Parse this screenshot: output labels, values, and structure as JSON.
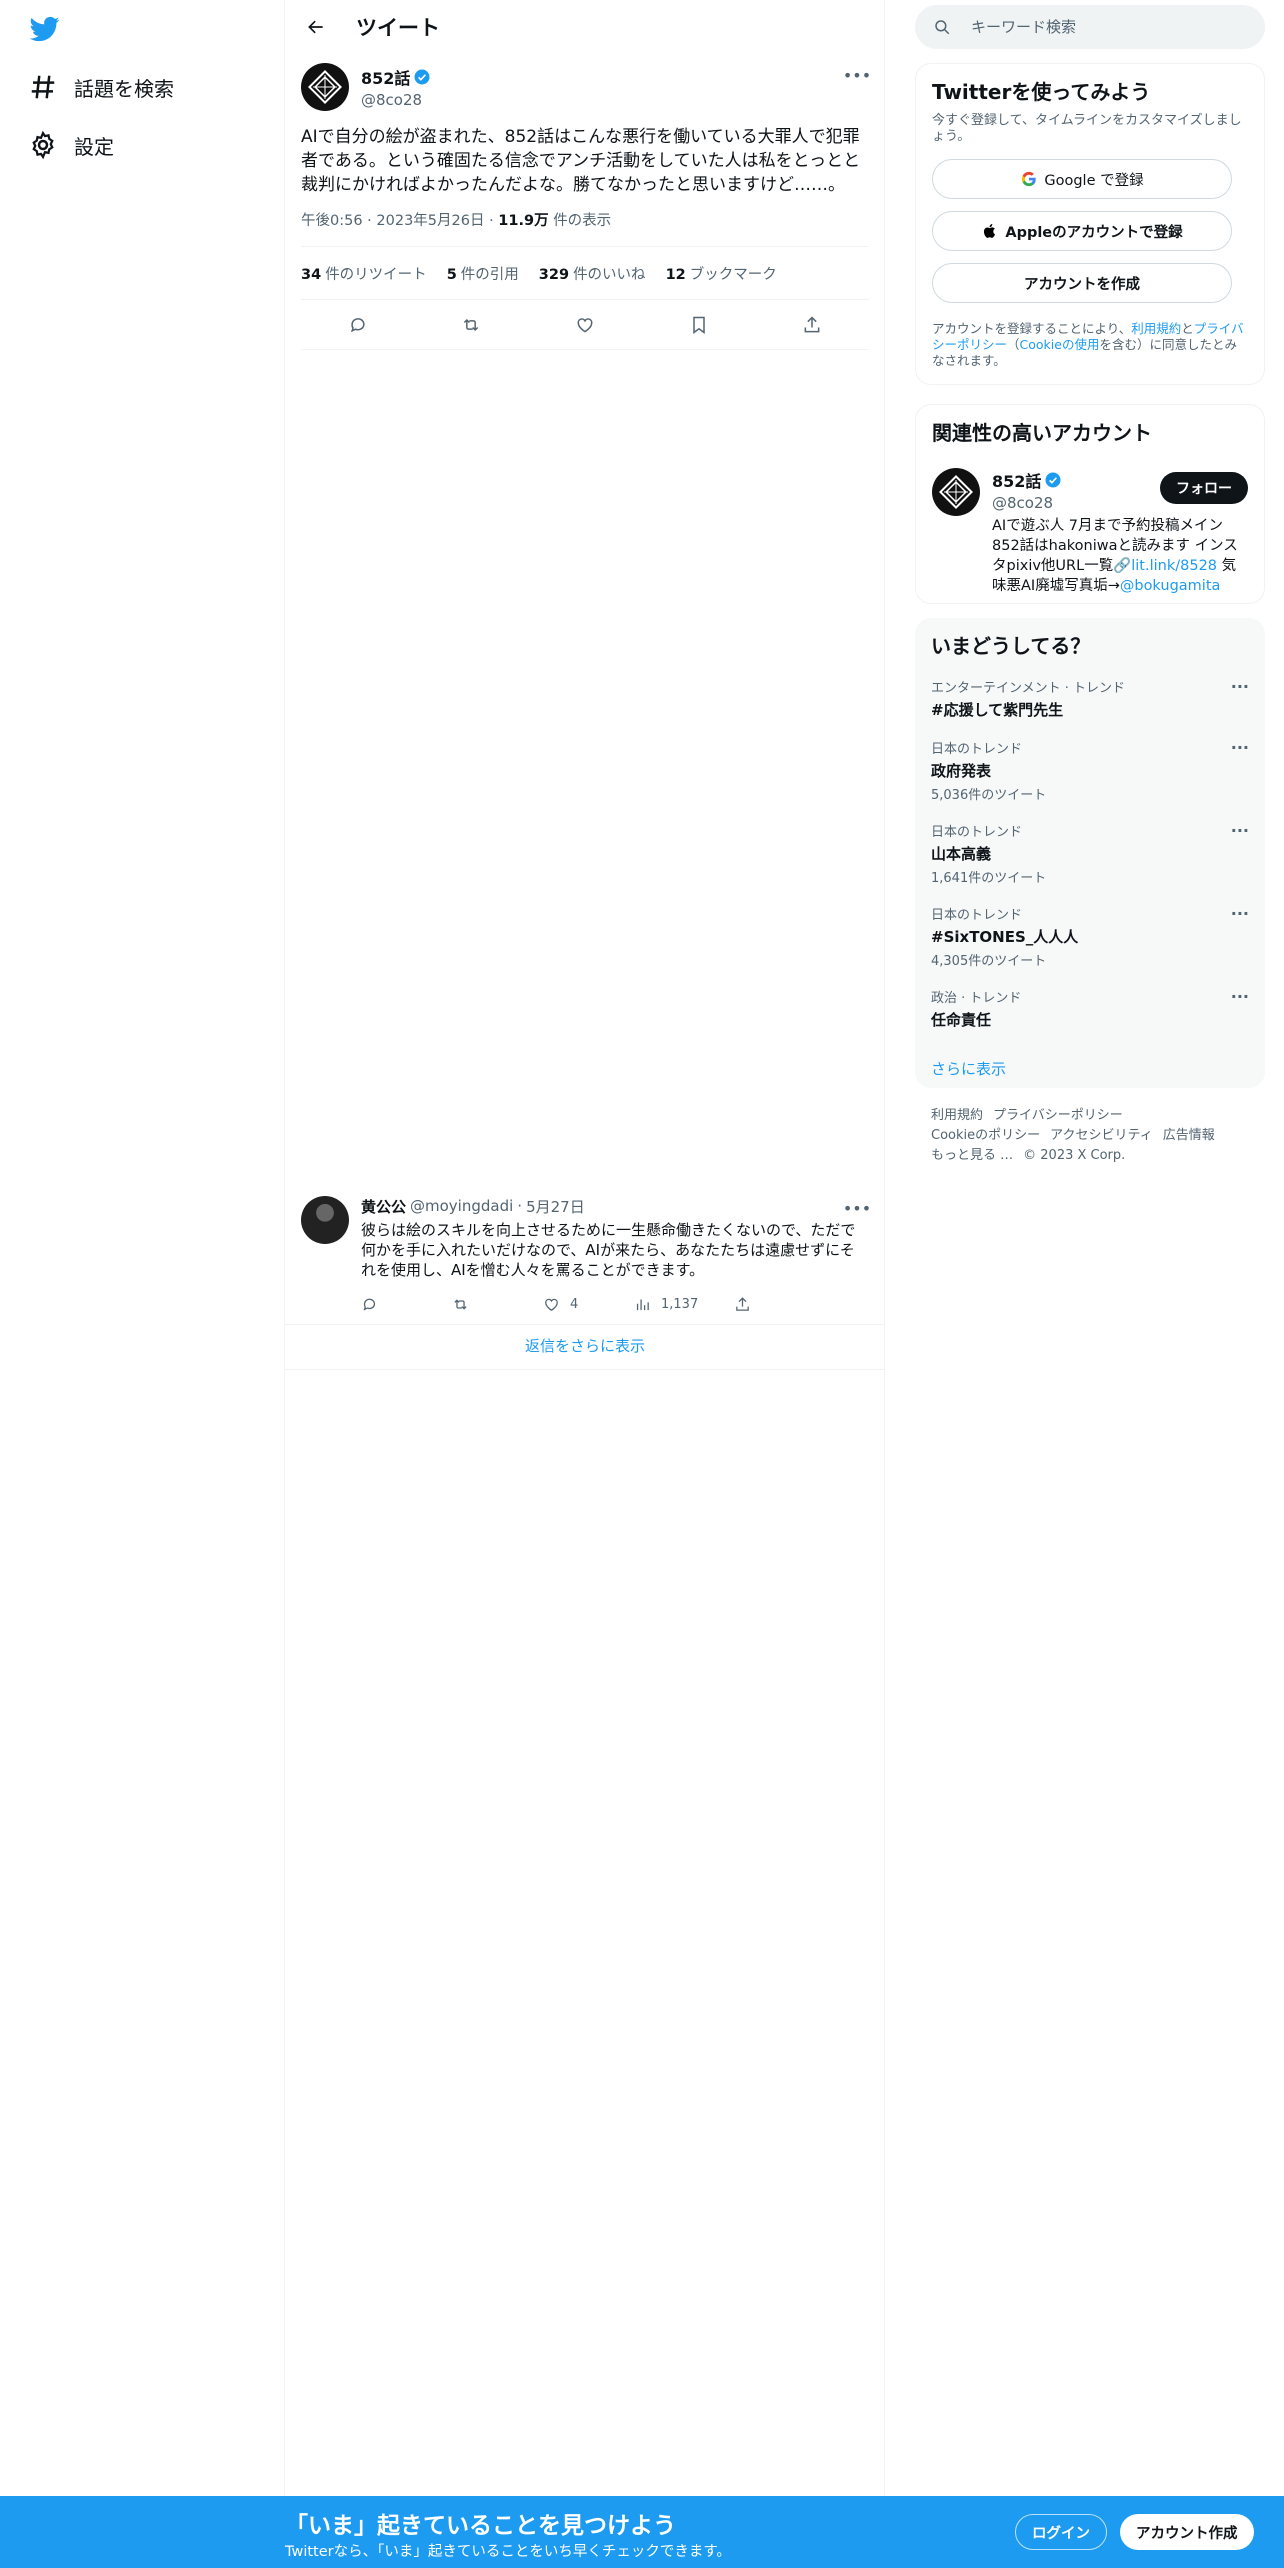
{
  "nav": {
    "logo": "twitter-bird-icon",
    "items": [
      {
        "label": "話題を検索",
        "icon": "hashtag-icon"
      },
      {
        "label": "設定",
        "icon": "gear-icon"
      }
    ]
  },
  "main": {
    "title": "ツイート",
    "tweet": {
      "display_name": "852話",
      "handle": "@8co28",
      "text": "AIで自分の絵が盗まれた、852話はこんな悪行を働いている大罪人で犯罪者である。という確固たる信念でアンチ活動をしていた人は私をとっとと裁判にかければよかったんだよな。勝てなかったと思いますけど……。",
      "time": "午後0:56",
      "date": "2023年5月26日",
      "views_count": "11.9万",
      "views_label": "件の表示",
      "stats": [
        {
          "count": "34",
          "label": "件のリツイート"
        },
        {
          "count": "5",
          "label": "件の引用"
        },
        {
          "count": "329",
          "label": "件のいいね"
        },
        {
          "count": "12",
          "label": "ブックマーク"
        }
      ]
    },
    "reply": {
      "display_name": "黄公公",
      "handle": "@moyingdadi",
      "date": "5月27日",
      "text": "彼らは絵のスキルを向上させるために一生懸命働きたくないので、ただで何かを手に入れたいだけなので、AIが来たら、あなたたちは遠慮せずにそれを使用し、AIを憎む人々を罵ることができます。",
      "likes": "4",
      "views": "1,137"
    },
    "show_more_replies": "返信をさらに表示"
  },
  "right": {
    "search_placeholder": "キーワード検索",
    "signup_card": {
      "title": "Twitterを使ってみよう",
      "subtitle": "今すぐ登録して、タイムラインをカスタマイズしましょう。",
      "google": "Google で登録",
      "apple": "Appleのアカウントで登録",
      "create": "アカウントを作成",
      "legal_pre": "アカウントを登録することにより、",
      "legal_terms": "利用規約",
      "legal_and": "と",
      "legal_privacy": "プライバシーポリシー",
      "legal_paren_open": "（",
      "legal_cookie": "Cookieの使用",
      "legal_post": "を含む）に同意したとみなされます。"
    },
    "relevant": {
      "title": "関連性の高いアカウント",
      "name": "852話",
      "handle": "@8co28",
      "follow": "フォロー",
      "bio_1": "AIで遊ぶ人 7月まで予約投稿メイン 852話はhakoniwaと読みます インスタpixiv他URL一覧🔗",
      "bio_link": "lit.link/8528",
      "bio_2": " 気味悪AI廃墟写真垢→",
      "bio_mention": "@bokugamita"
    },
    "trends": {
      "title": "いまどうしてる？",
      "items": [
        {
          "context": "エンターテインメント · トレンド",
          "name": "#応援して紫門先生",
          "count": ""
        },
        {
          "context": "日本のトレンド",
          "name": "政府発表",
          "count": "5,036件のツイート"
        },
        {
          "context": "日本のトレンド",
          "name": "山本高義",
          "count": "1,641件のツイート"
        },
        {
          "context": "日本のトレンド",
          "name": "#SixTONES_人人人",
          "count": "4,305件のツイート"
        },
        {
          "context": "政治 · トレンド",
          "name": "任命責任",
          "count": ""
        }
      ],
      "show_more": "さらに表示"
    },
    "footer": {
      "terms": "利用規約",
      "privacy": "プライバシーポリシー",
      "cookie": "Cookieのポリシー",
      "accessibility": "アクセシビリティ",
      "ads": "広告情報",
      "more": "もっと見る …",
      "copyright": "© 2023 X Corp."
    }
  },
  "bottom_bar": {
    "headline": "「いま」起きていることを見つけよう",
    "sub": "Twitterなら、「いま」起きていることをいち早くチェックできます。",
    "login": "ログイン",
    "signup": "アカウント作成"
  },
  "colors": {
    "accent": "#1d9bf0",
    "text": "#0f1419",
    "muted": "#536471"
  }
}
